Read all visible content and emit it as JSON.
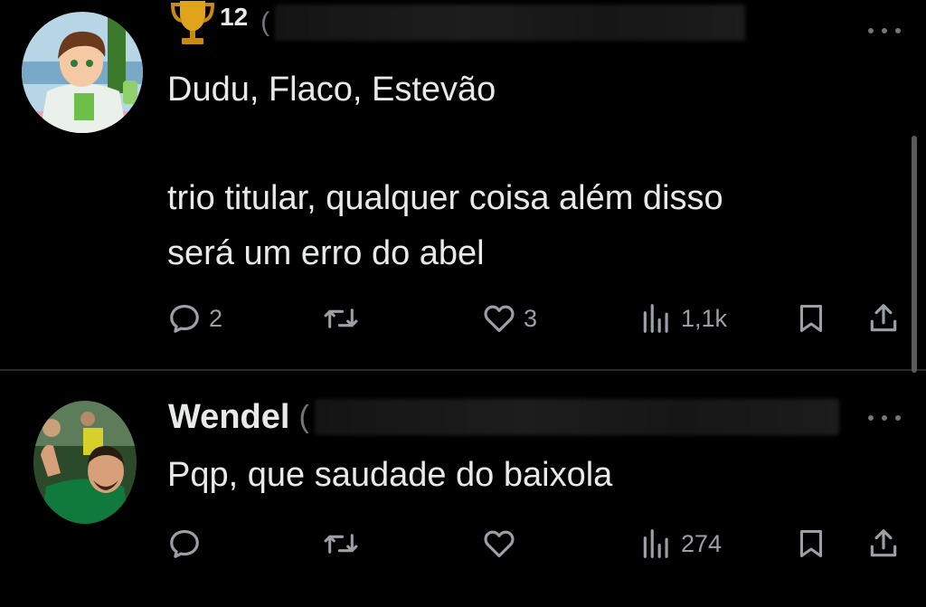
{
  "posts": [
    {
      "badge_count": "12",
      "handle_prefix": "(",
      "text_line1": "Dudu, Flaco, Estevão",
      "text_line2": "trio titular, qualquer coisa além disso",
      "text_line3": "será um erro do abel",
      "replies": "2",
      "reposts": "",
      "likes": "3",
      "views": "1,1k"
    },
    {
      "name": "Wendel",
      "handle_prefix": "(",
      "text_line1": "Pqp, que saudade do baixola",
      "replies": "",
      "reposts": "",
      "likes": "",
      "views": "274"
    }
  ],
  "icons": {
    "badge": "trophy-icon",
    "more": "more-dots-icon",
    "reply": "reply-icon",
    "repost": "repost-icon",
    "like": "heart-icon",
    "views": "views-bar-chart-icon",
    "bookmark": "bookmark-icon",
    "share": "share-icon"
  },
  "colors": {
    "background": "#000000",
    "text": "#e7e9ea",
    "muted": "#9aa0a6",
    "trophy": "#e0a41a"
  }
}
